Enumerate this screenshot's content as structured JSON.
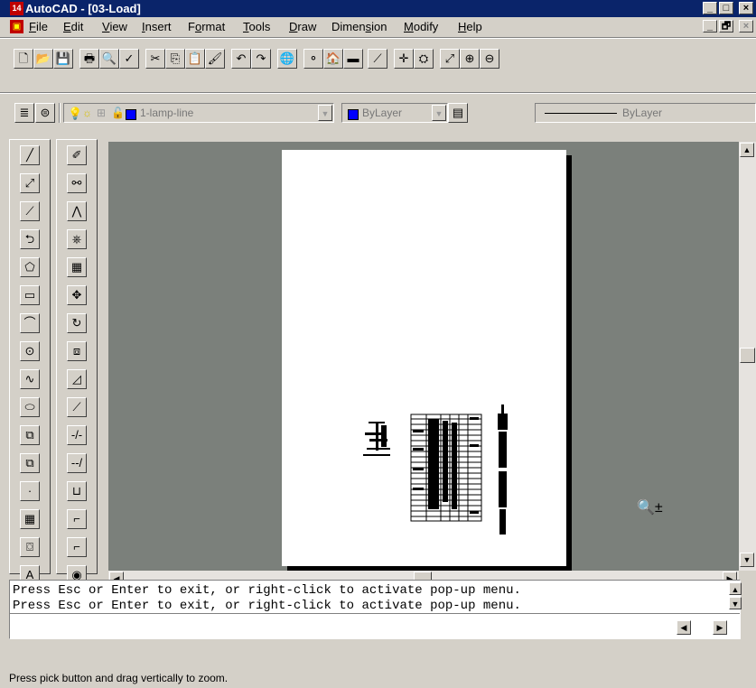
{
  "window": {
    "app_icon_text": "14",
    "title": "AutoCAD - [03-Load]",
    "controls": [
      "_",
      "□",
      "×"
    ],
    "doc_controls": [
      "_",
      "🗗",
      "×"
    ]
  },
  "menu": {
    "items": [
      {
        "pre": "",
        "u": "F",
        "post": "ile"
      },
      {
        "pre": "",
        "u": "E",
        "post": "dit"
      },
      {
        "pre": "",
        "u": "V",
        "post": "iew"
      },
      {
        "pre": "",
        "u": "I",
        "post": "nsert"
      },
      {
        "pre": "F",
        "u": "o",
        "post": "rmat"
      },
      {
        "pre": "",
        "u": "T",
        "post": "ools"
      },
      {
        "pre": "",
        "u": "D",
        "post": "raw"
      },
      {
        "pre": "Dimen",
        "u": "s",
        "post": "ion"
      },
      {
        "pre": "",
        "u": "M",
        "post": "odify"
      },
      {
        "pre": "",
        "u": "H",
        "post": "elp"
      }
    ]
  },
  "standard_toolbar": {
    "icons": [
      "new-icon",
      "open-icon",
      "save-icon",
      "print-icon",
      "preview-icon",
      "spell-icon",
      "cut-icon",
      "copy-icon",
      "paste-icon",
      "match-prop-icon",
      "undo-icon",
      "redo-icon",
      "hyperlink-icon",
      "snap-icon",
      "tracking-icon",
      "ucs-icon",
      "dist-icon",
      "pan-icon",
      "zoom-realtime-icon",
      "zoom-window-icon",
      "zoom-prev-icon"
    ],
    "glyphs": [
      "🗋",
      "📂",
      "💾",
      "🖶",
      "🔍",
      "✓",
      "✂",
      "⎘",
      "📋",
      "🖌",
      "↶",
      "↷",
      "🌐",
      "⚬",
      "🏠",
      "▬",
      "⟋",
      "✛",
      "⛭",
      "⤢",
      "⊕",
      "⊖"
    ]
  },
  "layer_toolbar": {
    "layer_name": "1-lamp-line",
    "color_value": "ByLayer",
    "linetype_value": "ByLayer",
    "colors": {
      "layer_blue": "#0000ff",
      "bulb_yellow": "#ffff00"
    }
  },
  "draw_toolbar": {
    "icons": [
      "line-icon",
      "construction-line-icon",
      "polyline-icon",
      "polygon-icon",
      "rectangle-icon",
      "arc-icon",
      "circle-icon",
      "spline-icon",
      "ellipse-icon",
      "insert-block-icon",
      "make-block-icon",
      "point-icon",
      "hatch-icon",
      "region-icon",
      "multiline-text-icon"
    ],
    "glyphs": [
      "╱",
      "⤢",
      "⟋",
      "⮌",
      "⬠",
      "▭",
      "⌒",
      "⊙",
      "∿",
      "⬭",
      "⧉",
      "⧉",
      "·",
      "▦",
      "⌼",
      "A"
    ]
  },
  "modify_toolbar": {
    "icons": [
      "erase-icon",
      "copy-object-icon",
      "mirror-icon",
      "offset-icon",
      "array-icon",
      "move-icon",
      "rotate-icon",
      "scale-icon",
      "stretch-icon",
      "lengthen-icon",
      "trim-icon",
      "extend-icon",
      "break-icon",
      "chamfer-icon",
      "fillet-icon",
      "explode-icon"
    ],
    "glyphs": [
      "✐",
      "⚯",
      "⋀",
      "⎈",
      "▦",
      "✥",
      "↻",
      "⧈",
      "◿",
      "⟋",
      "-/-",
      "--/",
      "⊔",
      "⌐",
      "⌐",
      "◉"
    ]
  },
  "cursor": {
    "name": "zoom-realtime-cursor",
    "glyph": "🔍±"
  },
  "command_line": {
    "lines": [
      "Press Esc or Enter to exit, or right-click to activate pop-up menu.",
      "Press Esc or Enter to exit, or right-click to activate pop-up menu."
    ],
    "prompt": ""
  },
  "status": {
    "text": "Press pick button and drag vertically to zoom."
  }
}
